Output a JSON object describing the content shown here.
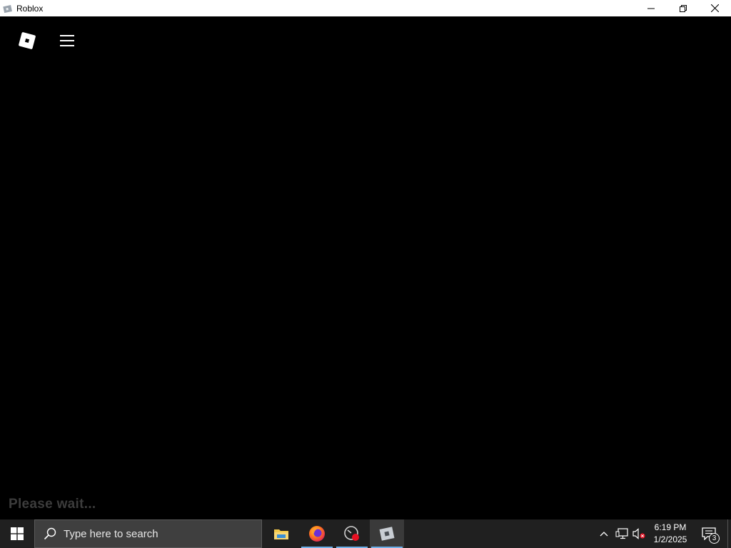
{
  "window": {
    "title": "Roblox",
    "app_icon": "roblox-icon",
    "controls": [
      "minimize-icon",
      "restore-icon",
      "close-icon"
    ]
  },
  "game": {
    "logo_icon": "roblox-logo-icon",
    "menu_icon": "hamburger-menu-icon",
    "loading_text": "Please wait..."
  },
  "taskbar": {
    "start_icon": "windows-start-icon",
    "search": {
      "icon": "search-icon",
      "placeholder": "Type here to search"
    },
    "apps": [
      {
        "name": "File Explorer",
        "icon": "folder-icon",
        "running": false,
        "active": false
      },
      {
        "name": "Firefox",
        "icon": "firefox-icon",
        "running": true,
        "active": false
      },
      {
        "name": "Recorder",
        "icon": "speedometer-record-icon",
        "running": true,
        "active": false
      },
      {
        "name": "Roblox",
        "icon": "roblox-icon",
        "running": true,
        "active": true
      }
    ],
    "tray": {
      "icons": [
        "chevron-up-icon",
        "network-icon",
        "volume-muted-icon"
      ],
      "time": "6:19 PM",
      "date": "1/2/2025",
      "notification_count": "3"
    }
  },
  "colors": {
    "taskbar_bg": "#202020",
    "accent_underline": "#6fb0e8",
    "loading_text": "#3c3c3c"
  }
}
